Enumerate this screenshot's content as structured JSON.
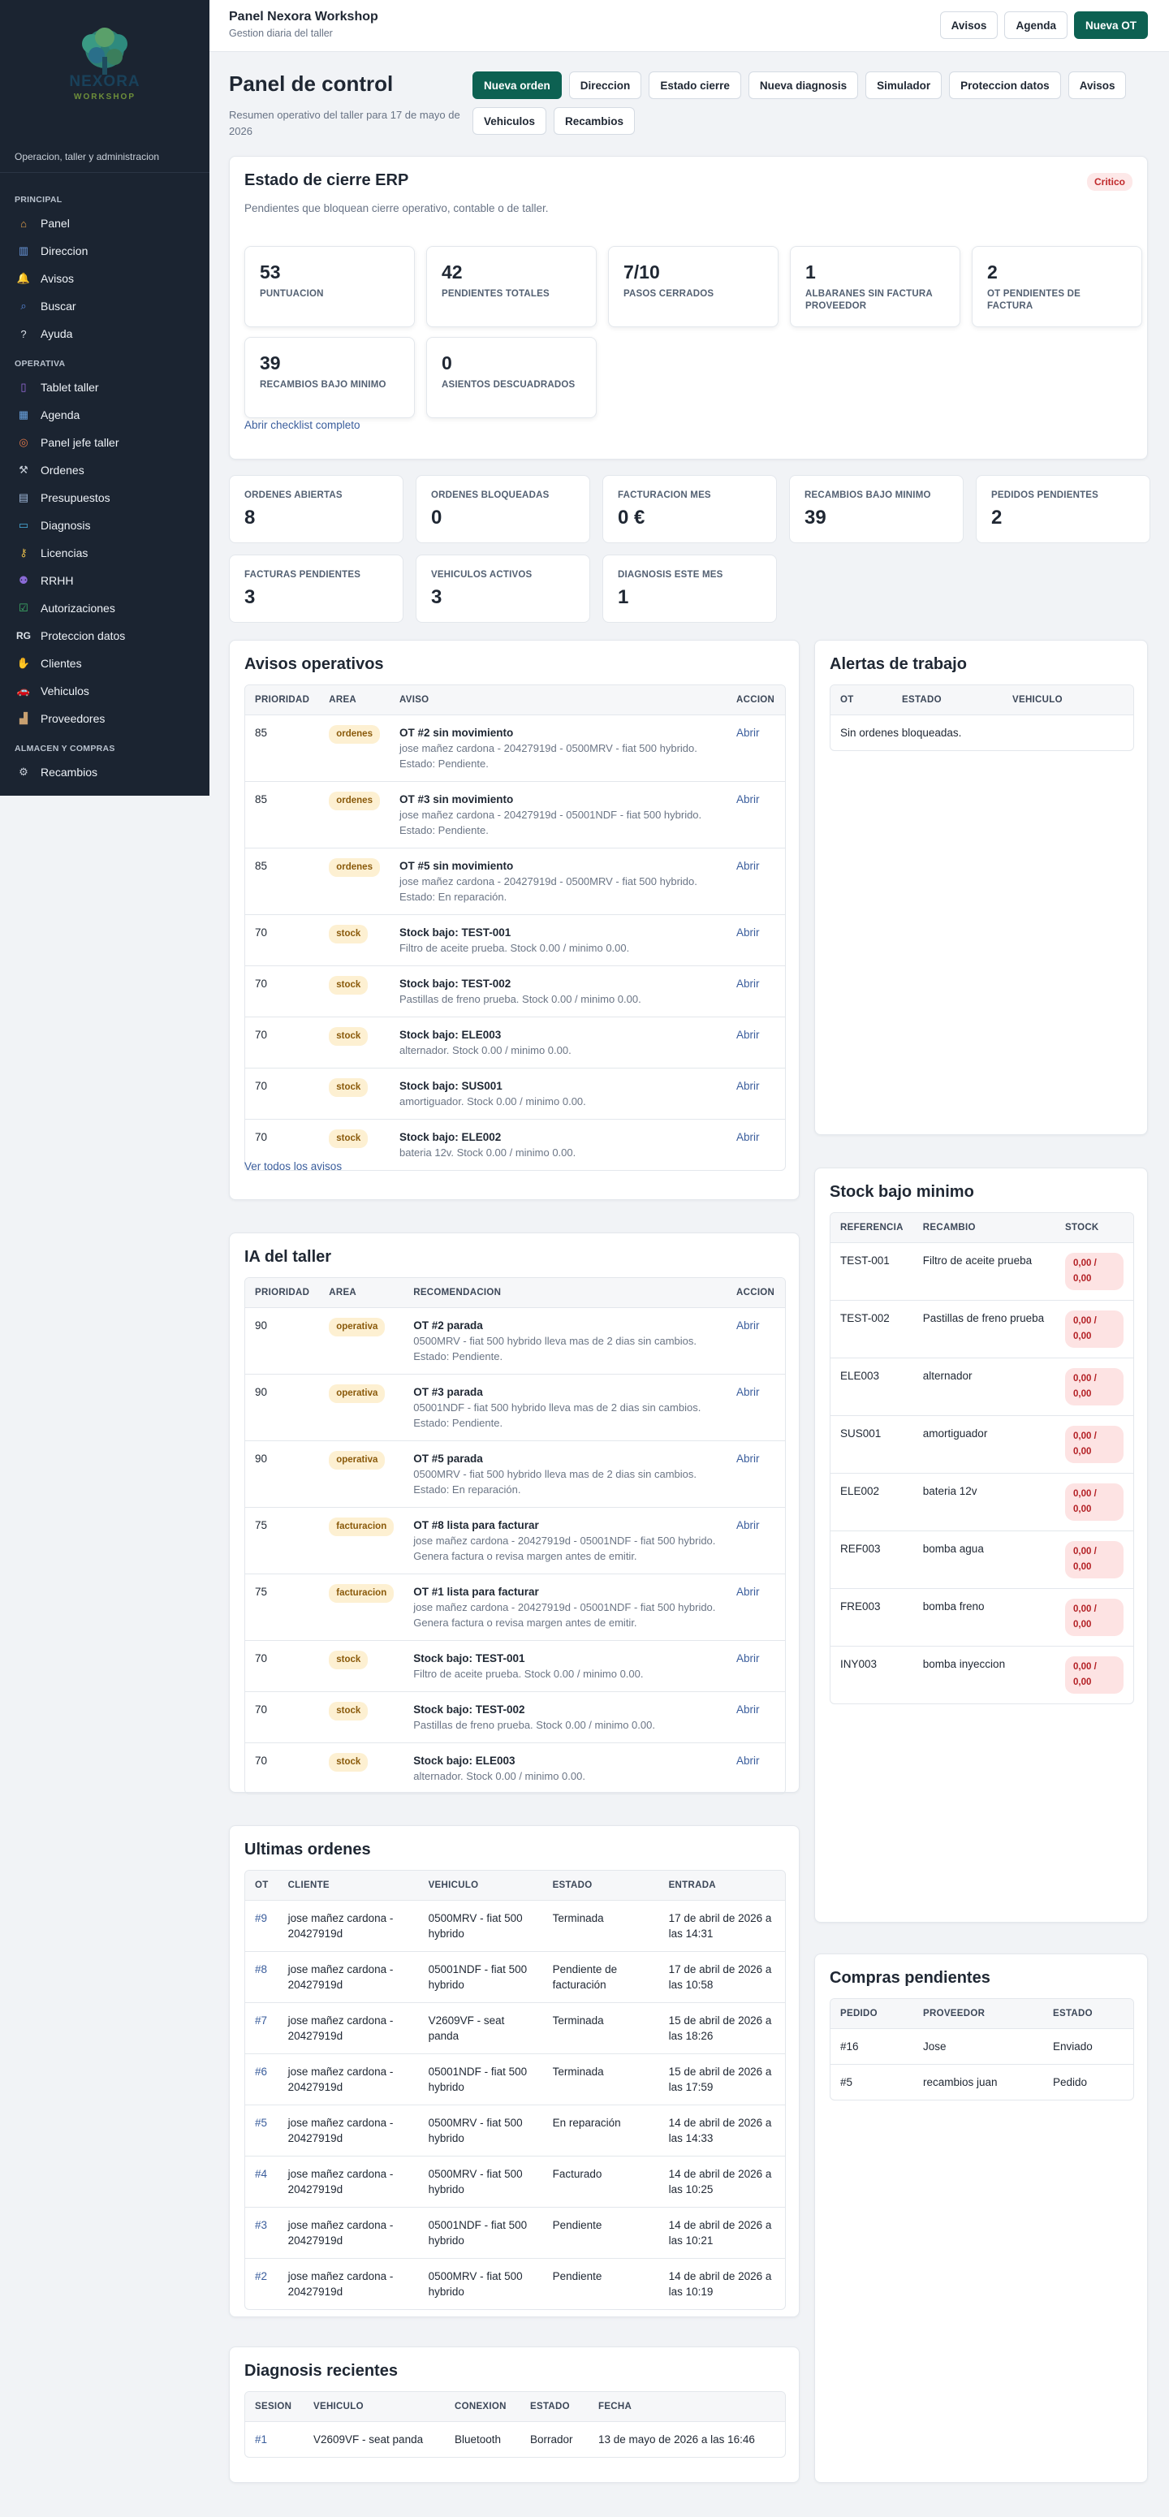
{
  "sidebar": {
    "brand": "NEXORA",
    "brand_sub": "WORKSHOP",
    "tagline": "Operacion, taller y administracion",
    "sections": [
      {
        "title": "PRINCIPAL",
        "items": [
          {
            "label": "Panel",
            "icon": "house-icon"
          },
          {
            "label": "Direccion",
            "icon": "chart-icon"
          },
          {
            "label": "Avisos",
            "icon": "bell-icon"
          },
          {
            "label": "Buscar",
            "icon": "search-icon"
          },
          {
            "label": "Ayuda",
            "icon": "question-icon"
          }
        ]
      },
      {
        "title": "OPERATIVA",
        "items": [
          {
            "label": "Tablet taller",
            "icon": "tablet-icon"
          },
          {
            "label": "Agenda",
            "icon": "calendar-icon"
          },
          {
            "label": "Panel jefe taller",
            "icon": "target-icon"
          },
          {
            "label": "Ordenes",
            "icon": "tools-icon"
          },
          {
            "label": "Presupuestos",
            "icon": "document-icon"
          },
          {
            "label": "Diagnosis",
            "icon": "monitor-icon"
          },
          {
            "label": "Licencias",
            "icon": "key-icon"
          },
          {
            "label": "RRHH",
            "icon": "people-icon"
          },
          {
            "label": "Autorizaciones",
            "icon": "checkbox-icon"
          },
          {
            "label": "Proteccion datos",
            "icon": "rg-icon",
            "glyph": "RG"
          },
          {
            "label": "Clientes",
            "icon": "handshake-icon"
          },
          {
            "label": "Vehiculos",
            "icon": "car-icon"
          },
          {
            "label": "Proveedores",
            "icon": "building-icon"
          }
        ]
      },
      {
        "title": "ALMACEN Y COMPRAS",
        "items": [
          {
            "label": "Recambios",
            "icon": "gear-icon"
          }
        ]
      }
    ]
  },
  "topbar": {
    "title": "Panel Nexora Workshop",
    "subtitle": "Gestion diaria del taller",
    "buttons": [
      "Avisos",
      "Agenda",
      "Nueva OT"
    ]
  },
  "page": {
    "title": "Panel de control",
    "subtitle": "Resumen operativo del taller para 17 de mayo de 2026",
    "actions": [
      "Nueva orden",
      "Direccion",
      "Estado cierre",
      "Nueva diagnosis",
      "Simulador",
      "Proteccion datos",
      "Avisos",
      "Vehiculos",
      "Recambios"
    ]
  },
  "erp": {
    "title": "Estado de cierre ERP",
    "badge": "Critico",
    "desc": "Pendientes que bloquean cierre operativo, contable o de taller.",
    "metrics": [
      {
        "value": "53",
        "label": "PUNTUACION"
      },
      {
        "value": "42",
        "label": "PENDIENTES TOTALES"
      },
      {
        "value": "7/10",
        "label": "PASOS CERRADOS"
      },
      {
        "value": "1",
        "label": "ALBARANES SIN FACTURA PROVEEDOR"
      },
      {
        "value": "2",
        "label": "OT PENDIENTES DE FACTURA"
      },
      {
        "value": "39",
        "label": "RECAMBIOS BAJO MINIMO"
      },
      {
        "value": "0",
        "label": "ASIENTOS DESCUADRADOS"
      }
    ],
    "link": "Abrir checklist completo"
  },
  "kpis": [
    {
      "label": "ORDENES ABIERTAS",
      "value": "8"
    },
    {
      "label": "ORDENES BLOQUEADAS",
      "value": "0"
    },
    {
      "label": "FACTURACION MES",
      "value": "0 €"
    },
    {
      "label": "RECAMBIOS BAJO MINIMO",
      "value": "39"
    },
    {
      "label": "PEDIDOS PENDIENTES",
      "value": "2"
    },
    {
      "label": "FACTURAS PENDIENTES",
      "value": "3"
    },
    {
      "label": "VEHICULOS ACTIVOS",
      "value": "3"
    },
    {
      "label": "DIAGNOSIS ESTE MES",
      "value": "1"
    }
  ],
  "avisos": {
    "title": "Avisos operativos",
    "headers": [
      "PRIORIDAD",
      "AREA",
      "AVISO",
      "ACCION"
    ],
    "rows": [
      {
        "prio": "85",
        "area": "ordenes",
        "title": "OT #2 sin movimiento",
        "desc": "jose mañez cardona - 20427919d - 0500MRV - fiat 500 hybrido. Estado: Pendiente.",
        "action": "Abrir"
      },
      {
        "prio": "85",
        "area": "ordenes",
        "title": "OT #3 sin movimiento",
        "desc": "jose mañez cardona - 20427919d - 05001NDF - fiat 500 hybrido. Estado: Pendiente.",
        "action": "Abrir"
      },
      {
        "prio": "85",
        "area": "ordenes",
        "title": "OT #5 sin movimiento",
        "desc": "jose mañez cardona - 20427919d - 0500MRV - fiat 500 hybrido. Estado: En reparación.",
        "action": "Abrir"
      },
      {
        "prio": "70",
        "area": "stock",
        "title": "Stock bajo: TEST-001",
        "desc": "Filtro de aceite prueba. Stock 0.00 / minimo 0.00.",
        "action": "Abrir"
      },
      {
        "prio": "70",
        "area": "stock",
        "title": "Stock bajo: TEST-002",
        "desc": "Pastillas de freno prueba. Stock 0.00 / minimo 0.00.",
        "action": "Abrir"
      },
      {
        "prio": "70",
        "area": "stock",
        "title": "Stock bajo: ELE003",
        "desc": "alternador. Stock 0.00 / minimo 0.00.",
        "action": "Abrir"
      },
      {
        "prio": "70",
        "area": "stock",
        "title": "Stock bajo: SUS001",
        "desc": "amortiguador. Stock 0.00 / minimo 0.00.",
        "action": "Abrir"
      },
      {
        "prio": "70",
        "area": "stock",
        "title": "Stock bajo: ELE002",
        "desc": "bateria 12v. Stock 0.00 / minimo 0.00.",
        "action": "Abrir"
      }
    ],
    "link": "Ver todos los avisos"
  },
  "alertas": {
    "title": "Alertas de trabajo",
    "headers": [
      "OT",
      "ESTADO",
      "VEHICULO"
    ],
    "empty": "Sin ordenes bloqueadas."
  },
  "ia": {
    "title": "IA del taller",
    "headers": [
      "PRIORIDAD",
      "AREA",
      "RECOMENDACION",
      "ACCION"
    ],
    "rows": [
      {
        "prio": "90",
        "area": "operativa",
        "title": "OT #2 parada",
        "desc": "0500MRV - fiat 500 hybrido lleva mas de 2 dias sin cambios. Estado: Pendiente.",
        "action": "Abrir"
      },
      {
        "prio": "90",
        "area": "operativa",
        "title": "OT #3 parada",
        "desc": "05001NDF - fiat 500 hybrido lleva mas de 2 dias sin cambios. Estado: Pendiente.",
        "action": "Abrir"
      },
      {
        "prio": "90",
        "area": "operativa",
        "title": "OT #5 parada",
        "desc": "0500MRV - fiat 500 hybrido lleva mas de 2 dias sin cambios. Estado: En reparación.",
        "action": "Abrir"
      },
      {
        "prio": "75",
        "area": "facturacion",
        "title": "OT #8 lista para facturar",
        "desc": "jose mañez cardona - 20427919d - 05001NDF - fiat 500 hybrido. Genera factura o revisa margen antes de emitir.",
        "action": "Abrir"
      },
      {
        "prio": "75",
        "area": "facturacion",
        "title": "OT #1 lista para facturar",
        "desc": "jose mañez cardona - 20427919d - 05001NDF - fiat 500 hybrido. Genera factura o revisa margen antes de emitir.",
        "action": "Abrir"
      },
      {
        "prio": "70",
        "area": "stock",
        "title": "Stock bajo: TEST-001",
        "desc": "Filtro de aceite prueba. Stock 0.00 / minimo 0.00.",
        "action": "Abrir"
      },
      {
        "prio": "70",
        "area": "stock",
        "title": "Stock bajo: TEST-002",
        "desc": "Pastillas de freno prueba. Stock 0.00 / minimo 0.00.",
        "action": "Abrir"
      },
      {
        "prio": "70",
        "area": "stock",
        "title": "Stock bajo: ELE003",
        "desc": "alternador. Stock 0.00 / minimo 0.00.",
        "action": "Abrir"
      }
    ]
  },
  "stock": {
    "title": "Stock bajo minimo",
    "headers": [
      "REFERENCIA",
      "RECAMBIO",
      "STOCK"
    ],
    "rows": [
      {
        "ref": "TEST-001",
        "name": "Filtro de aceite prueba",
        "stock": "0,00 / 0,00"
      },
      {
        "ref": "TEST-002",
        "name": "Pastillas de freno prueba",
        "stock": "0,00 / 0,00"
      },
      {
        "ref": "ELE003",
        "name": "alternador",
        "stock": "0,00 / 0,00"
      },
      {
        "ref": "SUS001",
        "name": "amortiguador",
        "stock": "0,00 / 0,00"
      },
      {
        "ref": "ELE002",
        "name": "bateria 12v",
        "stock": "0,00 / 0,00"
      },
      {
        "ref": "REF003",
        "name": "bomba agua",
        "stock": "0,00 / 0,00"
      },
      {
        "ref": "FRE003",
        "name": "bomba freno",
        "stock": "0,00 / 0,00"
      },
      {
        "ref": "INY003",
        "name": "bomba inyeccion",
        "stock": "0,00 / 0,00"
      }
    ]
  },
  "ordenes": {
    "title": "Ultimas ordenes",
    "headers": [
      "OT",
      "CLIENTE",
      "VEHICULO",
      "ESTADO",
      "ENTRADA"
    ],
    "rows": [
      {
        "ot": "#9",
        "cliente": "jose mañez cardona - 20427919d",
        "vehiculo": "0500MRV - fiat 500 hybrido",
        "estado": "Terminada",
        "entrada": "17 de abril de 2026 a las 14:31"
      },
      {
        "ot": "#8",
        "cliente": "jose mañez cardona - 20427919d",
        "vehiculo": "05001NDF - fiat 500 hybrido",
        "estado": "Pendiente de facturación",
        "entrada": "17 de abril de 2026 a las 10:58"
      },
      {
        "ot": "#7",
        "cliente": "jose mañez cardona - 20427919d",
        "vehiculo": "V2609VF - seat panda",
        "estado": "Terminada",
        "entrada": "15 de abril de 2026 a las 18:26"
      },
      {
        "ot": "#6",
        "cliente": "jose mañez cardona - 20427919d",
        "vehiculo": "05001NDF - fiat 500 hybrido",
        "estado": "Terminada",
        "entrada": "15 de abril de 2026 a las 17:59"
      },
      {
        "ot": "#5",
        "cliente": "jose mañez cardona - 20427919d",
        "vehiculo": "0500MRV - fiat 500 hybrido",
        "estado": "En reparación",
        "entrada": "14 de abril de 2026 a las 14:33"
      },
      {
        "ot": "#4",
        "cliente": "jose mañez cardona - 20427919d",
        "vehiculo": "0500MRV - fiat 500 hybrido",
        "estado": "Facturado",
        "entrada": "14 de abril de 2026 a las 10:25"
      },
      {
        "ot": "#3",
        "cliente": "jose mañez cardona - 20427919d",
        "vehiculo": "05001NDF - fiat 500 hybrido",
        "estado": "Pendiente",
        "entrada": "14 de abril de 2026 a las 10:21"
      },
      {
        "ot": "#2",
        "cliente": "jose mañez cardona - 20427919d",
        "vehiculo": "0500MRV - fiat 500 hybrido",
        "estado": "Pendiente",
        "entrada": "14 de abril de 2026 a las 10:19"
      }
    ]
  },
  "compras": {
    "title": "Compras pendientes",
    "headers": [
      "PEDIDO",
      "PROVEEDOR",
      "ESTADO"
    ],
    "rows": [
      {
        "pedido": "#16",
        "proveedor": "Jose",
        "estado": "Enviado"
      },
      {
        "pedido": "#5",
        "proveedor": "recambios juan",
        "estado": "Pedido"
      }
    ]
  },
  "diagnosis": {
    "title": "Diagnosis recientes",
    "headers": [
      "SESION",
      "VEHICULO",
      "CONEXION",
      "ESTADO",
      "FECHA"
    ],
    "rows": [
      {
        "sesion": "#1",
        "vehiculo": "V2609VF - seat panda",
        "conexion": "Bluetooth",
        "estado": "Borrador",
        "fecha": "13 de mayo de 2026 a las 16:46"
      }
    ]
  },
  "colors": {
    "primary": "#0d6152",
    "sidebar": "#1b2431",
    "link": "#3a5d9c",
    "critical": "#c0292b",
    "pill": "#fdf0d2"
  }
}
